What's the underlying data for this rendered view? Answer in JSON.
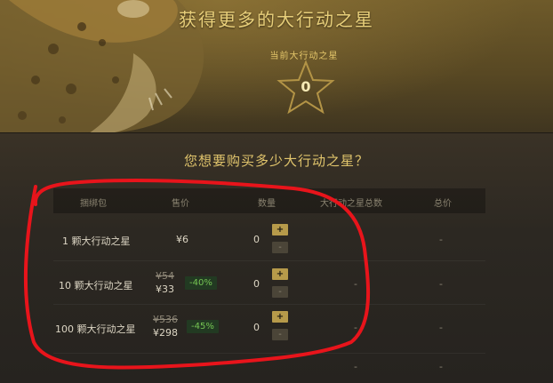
{
  "header": {
    "title": "获得更多的大行动之星",
    "current_label": "当前大行动之星",
    "current_count": "0"
  },
  "main": {
    "question": "您想要购买多少大行动之星？",
    "columns": {
      "bundle": "捆绑包",
      "price": "售价",
      "quantity": "数量",
      "total_stars": "大行动之星总数",
      "total_price": "总价"
    },
    "rows": [
      {
        "name": "1 颗大行动之星",
        "price": "¥6",
        "old_price": "",
        "discount": "",
        "qty": "0",
        "stars_total": "",
        "price_total": "-"
      },
      {
        "name": "10 颗大行动之星",
        "price": "¥33",
        "old_price": "¥54",
        "discount": "-40%",
        "qty": "0",
        "stars_total": "-",
        "price_total": "-"
      },
      {
        "name": "100 颗大行动之星",
        "price": "¥298",
        "old_price": "¥536",
        "discount": "-45%",
        "qty": "0",
        "stars_total": "-",
        "price_total": "-"
      }
    ],
    "plus_label": "+",
    "minus_label": "-",
    "totals": {
      "stars": "-",
      "price": "-"
    }
  },
  "colors": {
    "accent_gold": "#e0c46c",
    "discount_green": "#75c453",
    "annotation_red": "#e8141b"
  }
}
